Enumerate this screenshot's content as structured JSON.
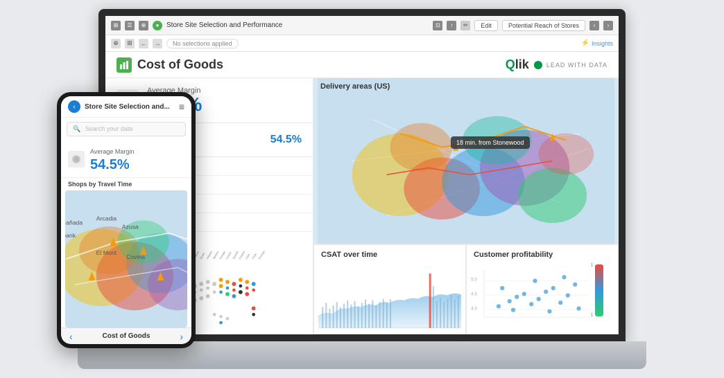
{
  "toolbar": {
    "title": "Store Site Selection and Performance",
    "edit_label": "Edit",
    "potential_label": "Potential Reach of Stores"
  },
  "sub_toolbar": {
    "selection_text": "No selections applied",
    "insights_label": "Insights"
  },
  "header": {
    "page_title": "Cost of Goods",
    "qlik_brand": "Qlik",
    "lead_text": "LEAD WITH DATA"
  },
  "metrics": {
    "average_margin_label": "Average Margin",
    "average_margin_value": "54.5%",
    "phone_average_margin_value": "54.5%"
  },
  "charts": {
    "avg_margin_title": "Average Margin",
    "delivery_map_title": "Delivery areas (US)",
    "csat_title": "CSAT over time",
    "customer_profit_title": "Customer profitability",
    "map_tooltip": "18 min. from Stonewood"
  },
  "phone": {
    "app_title": "Store Site Selection and...",
    "search_placeholder": "Search your data",
    "section_title": "Shops by Travel Time",
    "footer_title": "Cost of Goods",
    "back_icon": "‹",
    "menu_icon": "≡",
    "nav_prev": "‹",
    "nav_next": "›"
  },
  "countries": [
    "Brazil",
    "Germany",
    "Italy",
    "Argentina",
    "Uruguay",
    "France",
    "Spain",
    "Ireland",
    "Netherlands",
    "Hungary",
    "Czechoslovakia",
    "Sweden",
    "Poland",
    "USA",
    "Chile",
    "Portugal",
    "Austria",
    "Croatia"
  ],
  "pct_values": [
    "%",
    "%",
    "%",
    "%"
  ],
  "icons": {
    "chart_icon": "▦",
    "coin_icon": "🪙",
    "margin_icon": "▤"
  }
}
